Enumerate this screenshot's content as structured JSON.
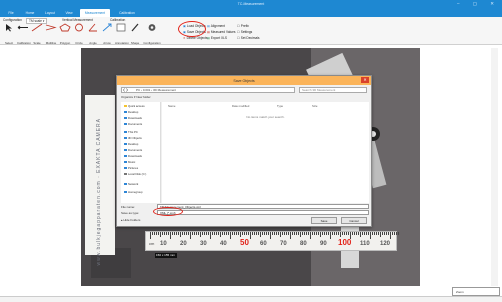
{
  "window": {
    "title": "TC-Measurement",
    "controls": "–  ▢  ✕"
  },
  "tabs": [
    {
      "label": "File"
    },
    {
      "label": "Home"
    },
    {
      "label": "Layout"
    },
    {
      "label": "View"
    },
    {
      "label": "Measurement"
    },
    {
      "label": "Calibration"
    }
  ],
  "ribbon": {
    "group1": "Configuration",
    "dropdown": "TM scale  ▾",
    "group2": "Vertical Measurement",
    "group3": "Calibration",
    "tools": [
      "Select",
      "Calibration",
      "Scale",
      "Multiline",
      "Polygon",
      "Circle",
      "Angle",
      "Arrow",
      "Annotation",
      "Shape",
      "Configuration"
    ],
    "buttons": {
      "load": "Load Objects",
      "save": "Save Objects",
      "delete": "Delete Objects",
      "align": "Alignment",
      "measure": "Measured Values",
      "export": "Export XLS",
      "prefix": "Prefix",
      "settings": "Settings",
      "decimal": "Set Decimals"
    }
  },
  "photo": {
    "side_text": "www.bulkjegapparaten.com  ·  EXAKTA CAMERA",
    "ruler_numbers": [
      "10",
      "20",
      "30",
      "40",
      "50",
      "60",
      "70",
      "80",
      "90",
      "100",
      "110",
      "120"
    ],
    "ruler_unit": "cm",
    "size_tag": "150 x 155 mm"
  },
  "dialog": {
    "title": "Save Objects",
    "close": "✕",
    "address": "PC › 0.001 › 3D Measurement",
    "search": "Search 3D Measurement",
    "toolbar": "Organize ▾    New folder",
    "columns": [
      "Name",
      "Date modified",
      "Type",
      "Size"
    ],
    "empty_message": "No items match your search.",
    "nav": [
      {
        "label": "Quick access",
        "color": "#f4c430"
      },
      {
        "label": "Desktop",
        "color": "#2f86d6"
      },
      {
        "label": "Downloads",
        "color": "#2f86d6"
      },
      {
        "label": "Documents",
        "color": "#2f86d6"
      },
      {
        "label": "This PC",
        "color": "#2f86d6"
      },
      {
        "label": "3D Objects",
        "color": "#2f86d6"
      },
      {
        "label": "Desktop",
        "color": "#2f86d6"
      },
      {
        "label": "Documents",
        "color": "#2f86d6"
      },
      {
        "label": "Downloads",
        "color": "#2f86d6"
      },
      {
        "label": "Music",
        "color": "#2f86d6"
      },
      {
        "label": "Pictures",
        "color": "#2f86d6"
      },
      {
        "label": "Local Disk (C:)",
        "color": "#777777"
      },
      {
        "label": "Network",
        "color": "#2f86d6"
      },
      {
        "label": "Homegroup",
        "color": "#2f86d6"
      }
    ],
    "filename_label": "File name:",
    "filename_value": "TM Measurement_Objects.xml",
    "savetype_label": "Save as type:",
    "savetype_value": "XML (*.xml)",
    "hide_folders": "▴  Hide Folders",
    "save_button": "Save",
    "cancel_button": "Cancel"
  },
  "statusbar": {
    "minimap_label": "Zoom"
  },
  "colors": {
    "accent": "#1e88d2",
    "dialog_title": "#fbb45a",
    "highlight": "#e2231a"
  }
}
